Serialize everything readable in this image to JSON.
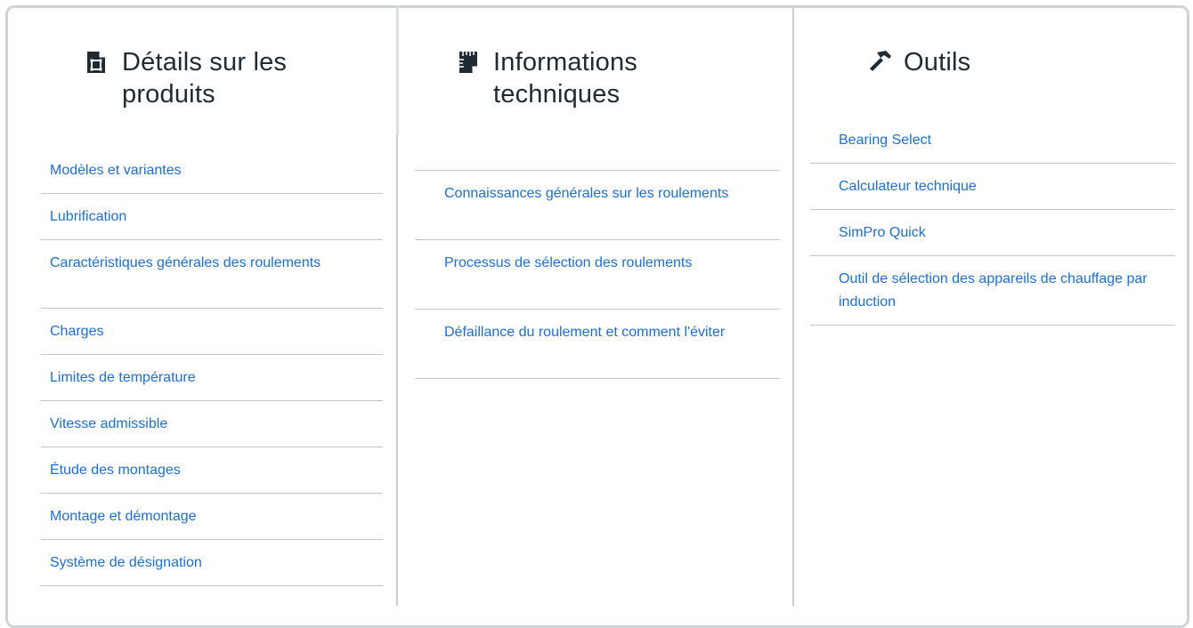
{
  "columns": [
    {
      "title": "Détails sur les produits",
      "icon": "product-document-icon",
      "links": [
        "Modèles et variantes",
        "Lubrification",
        "Caractéristiques générales des roulements",
        "Charges",
        "Limites de température",
        "Vitesse admissible",
        "Étude des montages",
        "Montage et démontage",
        "Système de désignation"
      ]
    },
    {
      "title": "Informations techniques",
      "icon": "technical-sheet-icon",
      "links": [
        "Connaissances générales sur les roulements",
        "Processus de sélection des roulements",
        "Défaillance du roulement et comment l'éviter"
      ]
    },
    {
      "title": "Outils",
      "icon": "tools-hammer-icon",
      "links": [
        "Bearing Select",
        "Calculateur technique",
        "SimPro Quick",
        "Outil de sélection des appareils de chauffage par induction"
      ]
    }
  ],
  "colors": {
    "link": "#1a6fd6",
    "title": "#1f2a33",
    "divider": "#c4c8cb",
    "frame": "#cfd3d6"
  }
}
